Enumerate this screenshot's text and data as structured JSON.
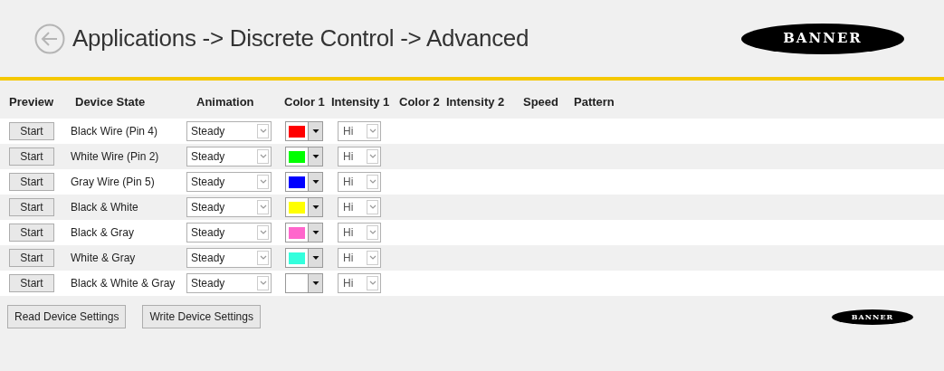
{
  "header": {
    "title": "Applications -> Discrete Control -> Advanced",
    "logo": "BANNER"
  },
  "table": {
    "columns": [
      "Preview",
      "Device State",
      "Animation",
      "Color 1",
      "Intensity 1",
      "Color 2",
      "Intensity 2",
      "Speed",
      "Pattern"
    ],
    "rows": [
      {
        "button": "Start",
        "state": "Black Wire (Pin 4)",
        "animation": "Steady",
        "color": "#ff0000",
        "intensity": "Hi"
      },
      {
        "button": "Start",
        "state": "White Wire (Pin 2)",
        "animation": "Steady",
        "color": "#00ff00",
        "intensity": "Hi"
      },
      {
        "button": "Start",
        "state": "Gray Wire (Pin 5)",
        "animation": "Steady",
        "color": "#0000ff",
        "intensity": "Hi"
      },
      {
        "button": "Start",
        "state": "Black & White",
        "animation": "Steady",
        "color": "#ffff00",
        "intensity": "Hi"
      },
      {
        "button": "Start",
        "state": "Black & Gray",
        "animation": "Steady",
        "color": "#ff66cc",
        "intensity": "Hi"
      },
      {
        "button": "Start",
        "state": "White & Gray",
        "animation": "Steady",
        "color": "#33ffdd",
        "intensity": "Hi"
      },
      {
        "button": "Start",
        "state": "Black & White & Gray",
        "animation": "Steady",
        "intensity": "Hi"
      }
    ]
  },
  "footer": {
    "buttons": [
      "Read Device Settings",
      "Write Device Settings"
    ],
    "logo": "BANNER"
  }
}
